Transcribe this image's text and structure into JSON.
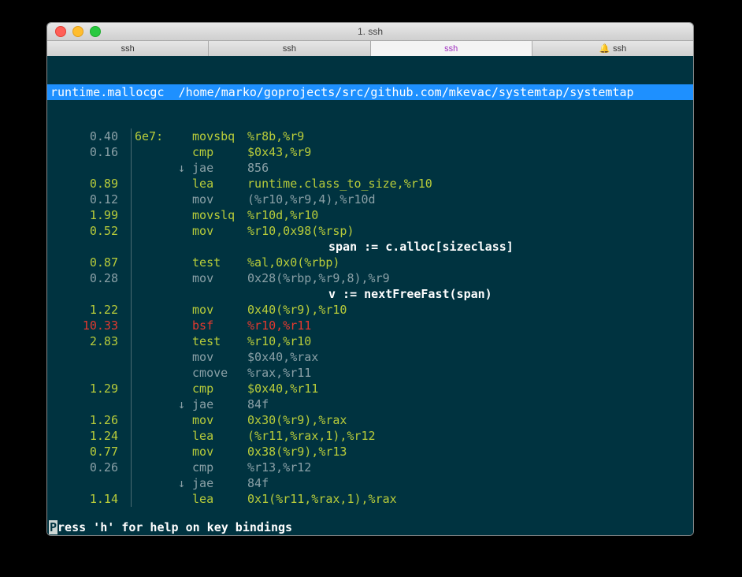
{
  "window": {
    "title": "1. ssh"
  },
  "tabs": [
    {
      "label": "ssh",
      "active": false,
      "bell": false
    },
    {
      "label": "ssh",
      "active": false,
      "bell": false
    },
    {
      "label": "ssh",
      "active": true,
      "bell": false
    },
    {
      "label": "ssh",
      "active": false,
      "bell": true
    }
  ],
  "header": {
    "func": "runtime.mallocgc",
    "path": "/home/marko/goprojects/src/github.com/mkevac/systemtap/systemtap"
  },
  "footer": {
    "first_char": "P",
    "rest": "ress 'h' for help on key bindings"
  },
  "lines": [
    {
      "pct": "0.40",
      "pct_color": "dim",
      "addr": "6e7:",
      "arrow": "",
      "mnem": "movsbq",
      "mnem_color": "olive",
      "ops": "%r8b,%r9",
      "ops_color": "olive"
    },
    {
      "pct": "0.16",
      "pct_color": "dim",
      "addr": "",
      "arrow": "",
      "mnem": "cmp",
      "mnem_color": "olive",
      "ops": "$0x43,%r9",
      "ops_color": "olive"
    },
    {
      "pct": "",
      "pct_color": "dim",
      "addr": "",
      "arrow": "↓",
      "mnem": "jae",
      "mnem_color": "dim",
      "ops": "856",
      "ops_color": "dim"
    },
    {
      "pct": "0.89",
      "pct_color": "olive",
      "addr": "",
      "arrow": "",
      "mnem": "lea",
      "mnem_color": "olive",
      "ops": "runtime.class_to_size,%r10",
      "ops_color": "olive"
    },
    {
      "pct": "0.12",
      "pct_color": "dim",
      "addr": "",
      "arrow": "",
      "mnem": "mov",
      "mnem_color": "dim",
      "ops": "(%r10,%r9,4),%r10d",
      "ops_color": "dim"
    },
    {
      "pct": "1.99",
      "pct_color": "olive",
      "addr": "",
      "arrow": "",
      "mnem": "movslq",
      "mnem_color": "olive",
      "ops": "%r10d,%r10",
      "ops_color": "olive"
    },
    {
      "pct": "0.52",
      "pct_color": "olive",
      "addr": "",
      "arrow": "",
      "mnem": "mov",
      "mnem_color": "olive",
      "ops": "%r10,0x98(%rsp)",
      "ops_color": "olive"
    },
    {
      "comment": true,
      "text": "span := c.alloc[sizeclass]"
    },
    {
      "pct": "0.87",
      "pct_color": "olive",
      "addr": "",
      "arrow": "",
      "mnem": "test",
      "mnem_color": "olive",
      "ops": "%al,0x0(%rbp)",
      "ops_color": "olive"
    },
    {
      "pct": "0.28",
      "pct_color": "dim",
      "addr": "",
      "arrow": "",
      "mnem": "mov",
      "mnem_color": "dim",
      "ops": "0x28(%rbp,%r9,8),%r9",
      "ops_color": "dim"
    },
    {
      "comment": true,
      "text": "v := nextFreeFast(span)"
    },
    {
      "pct": "1.22",
      "pct_color": "olive",
      "addr": "",
      "arrow": "",
      "mnem": "mov",
      "mnem_color": "olive",
      "ops": "0x40(%r9),%r10",
      "ops_color": "olive"
    },
    {
      "pct": "10.33",
      "pct_color": "red",
      "addr": "",
      "arrow": "",
      "mnem": "bsf",
      "mnem_color": "red",
      "ops": "%r10,%r11",
      "ops_color": "red"
    },
    {
      "pct": "2.83",
      "pct_color": "olive",
      "addr": "",
      "arrow": "",
      "mnem": "test",
      "mnem_color": "olive",
      "ops": "%r10,%r10",
      "ops_color": "olive"
    },
    {
      "pct": "",
      "pct_color": "dim",
      "addr": "",
      "arrow": "",
      "mnem": "mov",
      "mnem_color": "dim",
      "ops": "$0x40,%rax",
      "ops_color": "dim"
    },
    {
      "pct": "",
      "pct_color": "dim",
      "addr": "",
      "arrow": "",
      "mnem": "cmove",
      "mnem_color": "dim",
      "ops": "%rax,%r11",
      "ops_color": "dim"
    },
    {
      "pct": "1.29",
      "pct_color": "olive",
      "addr": "",
      "arrow": "",
      "mnem": "cmp",
      "mnem_color": "olive",
      "ops": "$0x40,%r11",
      "ops_color": "olive"
    },
    {
      "pct": "",
      "pct_color": "dim",
      "addr": "",
      "arrow": "↓",
      "mnem": "jae",
      "mnem_color": "dim",
      "ops": "84f",
      "ops_color": "dim"
    },
    {
      "pct": "1.26",
      "pct_color": "olive",
      "addr": "",
      "arrow": "",
      "mnem": "mov",
      "mnem_color": "olive",
      "ops": "0x30(%r9),%rax",
      "ops_color": "olive"
    },
    {
      "pct": "1.24",
      "pct_color": "olive",
      "addr": "",
      "arrow": "",
      "mnem": "lea",
      "mnem_color": "olive",
      "ops": "(%r11,%rax,1),%r12",
      "ops_color": "olive"
    },
    {
      "pct": "0.77",
      "pct_color": "olive",
      "addr": "",
      "arrow": "",
      "mnem": "mov",
      "mnem_color": "olive",
      "ops": "0x38(%r9),%r13",
      "ops_color": "olive"
    },
    {
      "pct": "0.26",
      "pct_color": "dim",
      "addr": "",
      "arrow": "",
      "mnem": "cmp",
      "mnem_color": "dim",
      "ops": "%r13,%r12",
      "ops_color": "dim"
    },
    {
      "pct": "",
      "pct_color": "dim",
      "addr": "",
      "arrow": "↓",
      "mnem": "jae",
      "mnem_color": "dim",
      "ops": "84f",
      "ops_color": "dim"
    },
    {
      "pct": "1.14",
      "pct_color": "olive",
      "addr": "",
      "arrow": "",
      "mnem": "lea",
      "mnem_color": "olive",
      "ops": "0x1(%r11,%rax,1),%rax",
      "ops_color": "olive"
    }
  ]
}
